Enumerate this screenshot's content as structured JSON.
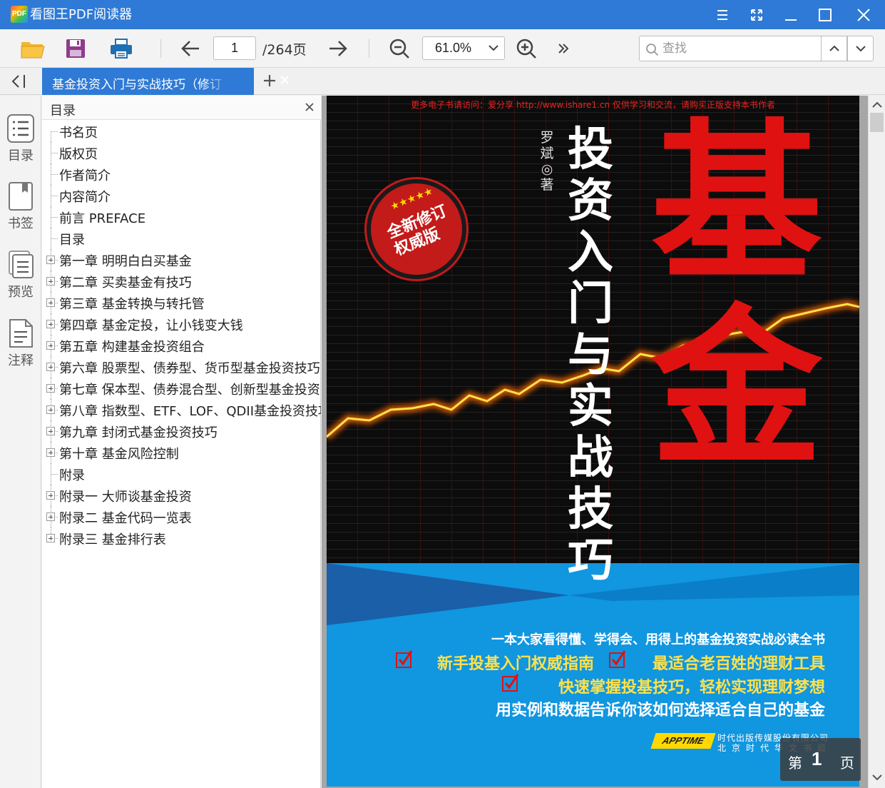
{
  "app": {
    "logo_text": "PDF",
    "title": "看图王PDF阅读器"
  },
  "toolbar": {
    "page_current": "1",
    "page_total": "/264页",
    "zoom": "61.0%",
    "search_placeholder": "查找"
  },
  "tab": {
    "label": "基金投资入门与实战技巧（修订"
  },
  "rail": [
    {
      "label": "目录"
    },
    {
      "label": "书签"
    },
    {
      "label": "预览"
    },
    {
      "label": "注释"
    }
  ],
  "toc": {
    "title": "目录",
    "items": [
      {
        "text": "书名页",
        "expandable": false
      },
      {
        "text": "版权页",
        "expandable": false
      },
      {
        "text": "作者简介",
        "expandable": false
      },
      {
        "text": "内容简介",
        "expandable": false
      },
      {
        "text": "前言 PREFACE",
        "expandable": false
      },
      {
        "text": "目录",
        "expandable": false
      },
      {
        "text": "第一章 明明白白买基金",
        "expandable": true
      },
      {
        "text": "第二章 买卖基金有技巧",
        "expandable": true
      },
      {
        "text": "第三章 基金转换与转托管",
        "expandable": true
      },
      {
        "text": "第四章 基金定投，让小钱变大钱",
        "expandable": true
      },
      {
        "text": "第五章 构建基金投资组合",
        "expandable": true
      },
      {
        "text": "第六章 股票型、债券型、货币型基金投资技巧",
        "expandable": true
      },
      {
        "text": "第七章 保本型、债券混合型、创新型基金投资",
        "expandable": true
      },
      {
        "text": "第八章 指数型、ETF、LOF、QDII基金投资技巧",
        "expandable": true
      },
      {
        "text": "第九章 封闭式基金投资技巧",
        "expandable": true
      },
      {
        "text": "第十章 基金风险控制",
        "expandable": true
      },
      {
        "text": "附录",
        "expandable": false
      },
      {
        "text": "附录一 大师谈基金投资",
        "expandable": true
      },
      {
        "text": "附录二 基金代码一览表",
        "expandable": true
      },
      {
        "text": "附录三 基金排行表",
        "expandable": true
      }
    ]
  },
  "cover": {
    "watermark": "更多电子书请访问：爱分享 http://www.ishare1.cn  仅供学习和交流，请购买正版支持本书作者",
    "author": "罗斌◎著",
    "subtitle": "投资入门与实战技巧",
    "big_title": "基金",
    "badge_line1": "全新修订",
    "badge_line2": "权威版",
    "tagline": "一本大家看得懂、学得会、用得上的基金投资实战必读全书",
    "bullet1": "新手投基入门权威指南",
    "bullet2": "最适合老百姓的理财工具",
    "bullet3": "快速掌握投基技巧，轻松实现理财梦想",
    "bottom_line": "用实例和数据告诉你该如何选择适合自己的基金",
    "publisher_logo": "APPTIME",
    "publisher1": "时代出版传媒股份有限公司",
    "publisher2": "北京时代华文书局"
  },
  "page_indicator": {
    "prefix": "第",
    "number": "1",
    "suffix": "页"
  },
  "colors": {
    "accent": "#2e7ad6",
    "cover_red": "#e01111",
    "cover_blue": "#1196e0",
    "cover_yellow": "#ffe14a"
  }
}
